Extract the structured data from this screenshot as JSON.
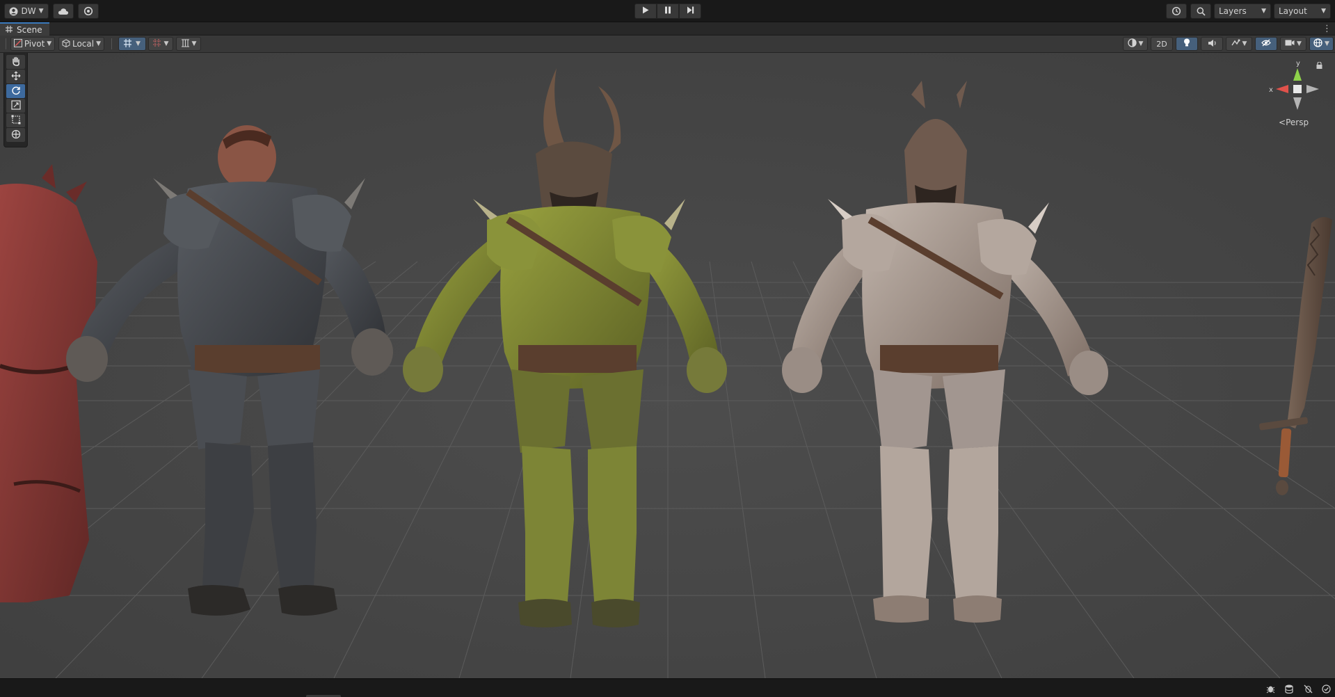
{
  "toolbar": {
    "account_label": "DW",
    "layers_label": "Layers",
    "layout_label": "Layout",
    "icons": [
      "account-icon",
      "cloud-icon",
      "settings-icon",
      "play-icon",
      "pause-icon",
      "step-icon",
      "history-icon",
      "search-icon"
    ]
  },
  "tab": {
    "title": "Scene"
  },
  "scene_toolbar": {
    "pivot_label": "Pivot",
    "local_label": "Local",
    "mode_2d_label": "2D"
  },
  "viewport": {
    "camera_label": "Persp",
    "gizmo_axes": {
      "x": "x",
      "y": "y"
    },
    "background_color": "#474747",
    "grid_color": "#5a5a5a",
    "characters": [
      {
        "name": "red-armored-orc",
        "armor_color": "#8a3a36"
      },
      {
        "name": "dark-armored-orc",
        "armor_color": "#4a4d52"
      },
      {
        "name": "green-armored-orc",
        "armor_color": "#7f8a33"
      },
      {
        "name": "white-armored-orc",
        "armor_color": "#a69a92"
      },
      {
        "name": "serrated-sword",
        "armor_color": "#6b5446"
      }
    ]
  },
  "tools": [
    "hand-tool",
    "move-tool",
    "rotate-tool",
    "scale-tool",
    "rect-tool",
    "transform-tool"
  ],
  "active_tool": "rotate-tool",
  "accent_color": "#3a79bb"
}
